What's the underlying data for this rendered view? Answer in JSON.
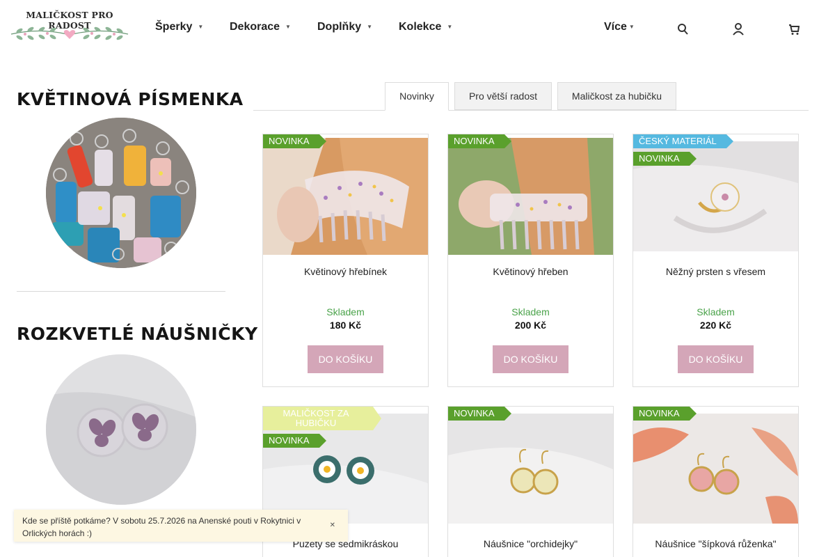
{
  "header": {
    "logo_text": "MALIČKOST PRO RADOST",
    "nav": [
      {
        "label": "Šperky"
      },
      {
        "label": "Dekorace"
      },
      {
        "label": "Doplňky"
      },
      {
        "label": "Kolekce"
      }
    ],
    "more_label": "Více",
    "icons": [
      "search-icon",
      "user-icon",
      "cart-icon"
    ]
  },
  "sidebar": {
    "banners": [
      {
        "title": "KVĚTINOVÁ PÍSMENKA"
      },
      {
        "title": "ROZKVETLÉ NÁUŠNIČKY"
      }
    ]
  },
  "tabs": [
    {
      "label": "Novinky",
      "active": true
    },
    {
      "label": "Pro větší radost",
      "active": false
    },
    {
      "label": "Maličkost za hubičku",
      "active": false
    }
  ],
  "products": [
    {
      "name": "Květinový hřebínek",
      "stock": "Skladem",
      "price": "180 Kč",
      "button": "DO KOŠÍKU",
      "flags": [
        "NOVINKA"
      ]
    },
    {
      "name": "Květinový hřeben",
      "stock": "Skladem",
      "price": "200 Kč",
      "button": "DO KOŠÍKU",
      "flags": [
        "NOVINKA"
      ]
    },
    {
      "name": "Něžný prsten s vřesem",
      "stock": "Skladem",
      "price": "220 Kč",
      "button": "DO KOŠÍKU",
      "flags": [
        "ČESKÝ MATERIÁL",
        "NOVINKA"
      ]
    },
    {
      "name": "Puzety se sedmikráskou",
      "flags": [
        "MALIČKOST ZA HUBIČKU",
        "NOVINKA"
      ]
    },
    {
      "name": "Náušnice \"orchidejky\"",
      "flags": [
        "NOVINKA"
      ]
    },
    {
      "name": "Náušnice \"šípková růženka\"",
      "flags": [
        "NOVINKA"
      ]
    }
  ],
  "infobar": {
    "text": "Kde se příště potkáme? V sobotu 25.7.2026 na Anenské pouti v Rokytnici v Orlických horách :)",
    "close_icon": "close-icon"
  },
  "colors": {
    "button": "#d4a6b8",
    "flag_new": "#5aa02c",
    "flag_czech": "#55b9e0",
    "flag_mali": "#e7ef9c",
    "stock": "#4aa34a"
  }
}
